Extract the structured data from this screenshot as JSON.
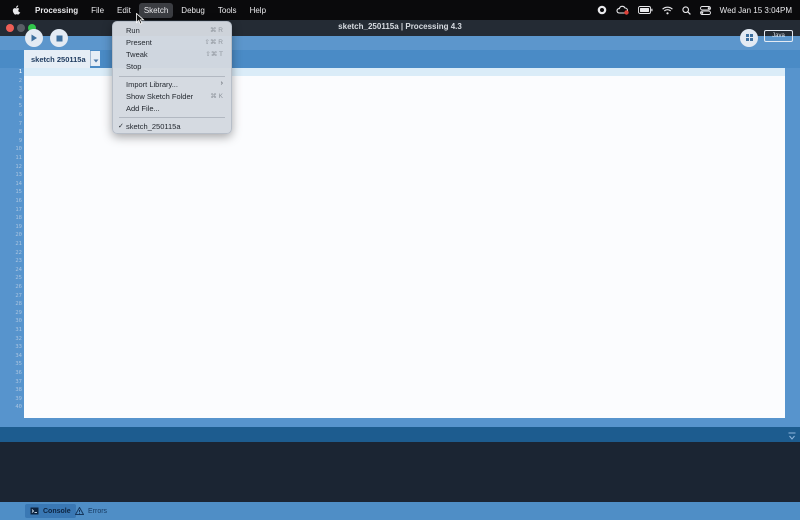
{
  "menubar": {
    "app_name": "Processing",
    "items": [
      "File",
      "Edit",
      "Sketch",
      "Debug",
      "Tools",
      "Help"
    ],
    "active_item": "Sketch",
    "clock": "Wed Jan 15  3:04PM"
  },
  "window": {
    "title": "sketch_250115a | Processing 4.3"
  },
  "toolbar": {
    "mode_label": "Java"
  },
  "tab": {
    "label": "sketch 250115a"
  },
  "editor": {
    "line_numbers": [
      "1",
      "2",
      "3",
      "4",
      "5",
      "6",
      "7",
      "8",
      "9",
      "10",
      "11",
      "12",
      "13",
      "14",
      "15",
      "16",
      "17",
      "18",
      "19",
      "20",
      "21",
      "22",
      "23",
      "24",
      "25",
      "26",
      "27",
      "28",
      "29",
      "30",
      "31",
      "32",
      "33",
      "34",
      "35",
      "36",
      "37",
      "38",
      "39",
      "40"
    ],
    "current_line": 1
  },
  "console": {
    "tabs": [
      "Console",
      "Errors"
    ],
    "active_tab": "Console"
  },
  "sketch_menu": {
    "items": [
      {
        "label": "Run",
        "shortcut": "⌘ R"
      },
      {
        "label": "Present",
        "shortcut": "⇧⌘ R"
      },
      {
        "label": "Tweak",
        "shortcut": "⇧⌘ T"
      },
      {
        "label": "Stop",
        "shortcut": ""
      },
      {
        "label": "Import Library...",
        "submenu": true
      },
      {
        "label": "Show Sketch Folder",
        "shortcut": "⌘ K"
      },
      {
        "label": "Add File...",
        "shortcut": ""
      },
      {
        "label": "sketch_250115a",
        "checked": true
      }
    ]
  },
  "colors": {
    "accent_blue": "#5794cd",
    "menubar_bg": "#0a0a0c",
    "console_bg": "#1b2533"
  }
}
